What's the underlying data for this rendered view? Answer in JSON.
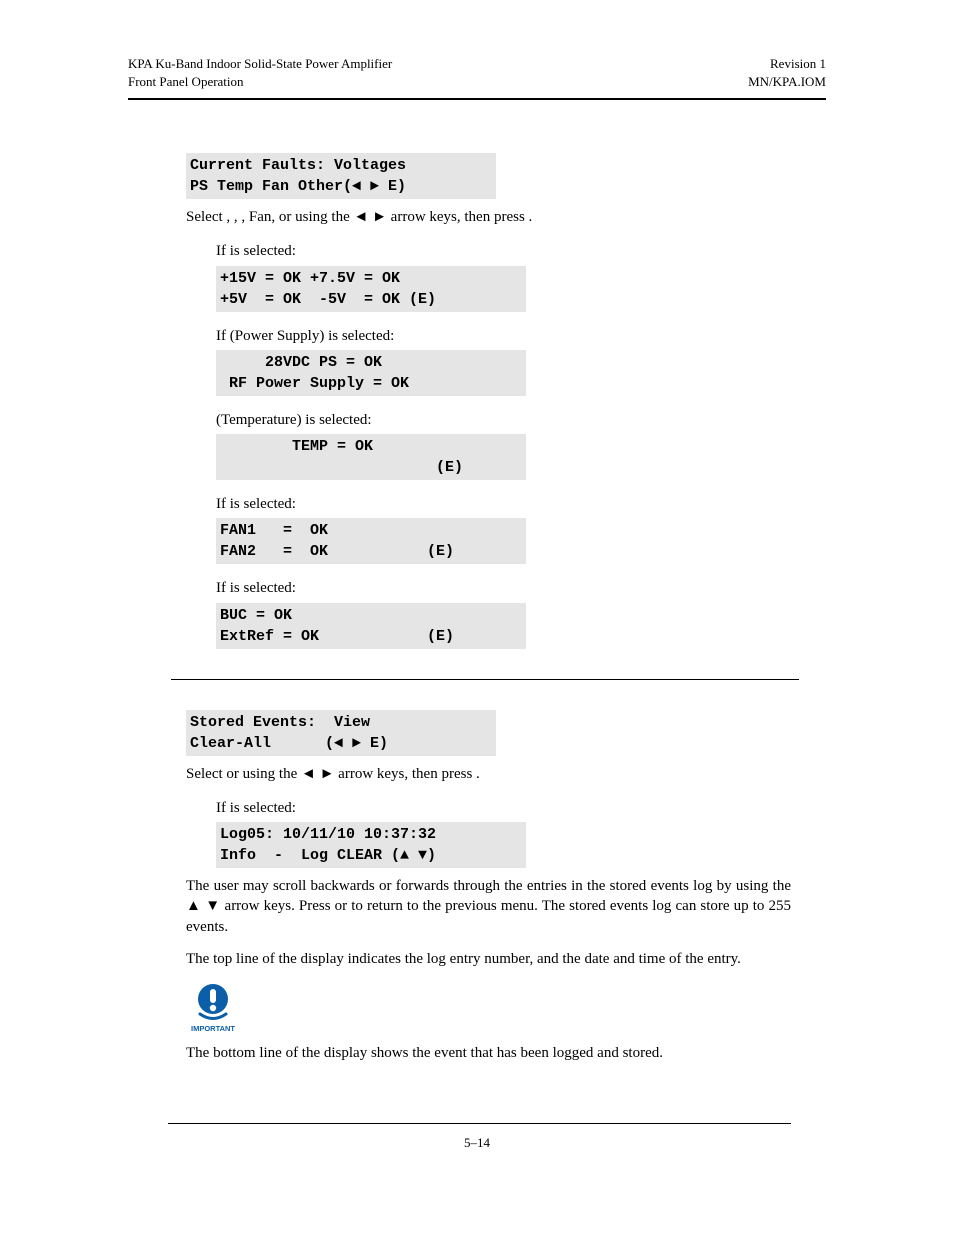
{
  "header": {
    "left1": "KPA Ku-Band Indoor Solid-State Power Amplifier",
    "left2": "Front Panel Operation",
    "right1": "Revision 1",
    "right2": "MN/KPA.IOM"
  },
  "faults": {
    "box1_l1": "Current Faults: Voltages",
    "box1_l2": "PS Temp Fan Other(◄ ► E)",
    "select_line": "Select           ,     ,         , Fan, or           using the ◄ ►  arrow keys, then press           .",
    "if_volt": "If            is selected:",
    "box_volt_l1": "+15V = OK +7.5V = OK",
    "box_volt_l2": "+5V  = OK  -5V  = OK (E)",
    "if_ps": "If       (Power Supply) is selected:",
    "box_ps_l1": "     28VDC PS = OK",
    "box_ps_l2": " RF Power Supply = OK",
    "if_temp": "           (Temperature) is selected:",
    "box_temp_l1": "        TEMP = OK",
    "box_temp_l2": "                        (E)",
    "if_fan": "If        is selected:",
    "box_fan_l1": "FAN1   =  OK",
    "box_fan_l2": "FAN2   =  OK           (E)",
    "if_other": "If          is selected:",
    "box_other_l1": "BUC = OK",
    "box_other_l2": "ExtRef = OK            (E)"
  },
  "events": {
    "box1_l1": "Stored Events:  View",
    "box1_l2": "Clear-All      (◄ ► E)",
    "select_line": "Select          or                   using the ◄ ►  arrow keys, then press           .",
    "if_view": "If          is selected:",
    "box_view_l1": "Log05: 10/11/10 10:37:32",
    "box_view_l2": "Info  -  Log CLEAR (▲ ▼)",
    "para1": "The  user  may  scroll  backwards  or  forwards  through  the  entries  in  the  stored  events  log  by using  the  ▲ ▼  arrow  keys.  Press               or               to  return  to  the  previous  menu.  The stored events log can store up to 255 events.",
    "para2": "The top line of the display indicates the log entry number, and the date and time of the entry.",
    "para3": "The bottom line of the display shows the event that has been logged and stored."
  },
  "important_label": "IMPORTANT",
  "page_number": "5–14"
}
